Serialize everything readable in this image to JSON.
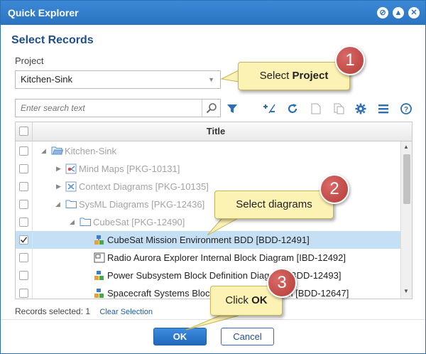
{
  "window": {
    "title": "Quick Explorer"
  },
  "dialog": {
    "heading": "Select Records",
    "project_label": "Project",
    "project_value": "Kitchen-Sink",
    "search_placeholder": "Enter search text"
  },
  "grid": {
    "column_title": "Title",
    "rows": [
      {
        "label": "Kitchen-Sink"
      },
      {
        "label": "Mind Maps [PKG-10131]"
      },
      {
        "label": "Context Diagrams [PKG-10135]"
      },
      {
        "label": "SysML Diagrams [PKG-12436]"
      },
      {
        "label": "CubeSat [PKG-12490]"
      },
      {
        "label": "CubeSat Mission Environment BDD [BDD-12491]",
        "checked": true
      },
      {
        "label": "Radio Aurora Explorer Internal Block Diagram [IBD-12492]"
      },
      {
        "label": "Power Subsystem Block Definition Diagram [BDD-12493]"
      },
      {
        "label": "Spacecraft Systems Block Definition Diagram [BDD-12647]"
      }
    ]
  },
  "status": {
    "records_label": "Records selected:",
    "records_count": "1",
    "clear_selection": "Clear Selection"
  },
  "buttons": {
    "ok": "OK",
    "cancel": "Cancel"
  },
  "callouts": {
    "c1": {
      "prefix": "Select ",
      "bold": "Project",
      "number": "1"
    },
    "c2": {
      "text": "Select diagrams",
      "number": "2"
    },
    "c3": {
      "prefix": "Click ",
      "bold": "OK",
      "number": "3"
    }
  },
  "colors": {
    "titlebar": "#2a73c1",
    "accent": "#1f4e8c",
    "callout_bg": "#fcf2b4",
    "badge": "#b33a36",
    "selected_row": "#c5dff5"
  }
}
